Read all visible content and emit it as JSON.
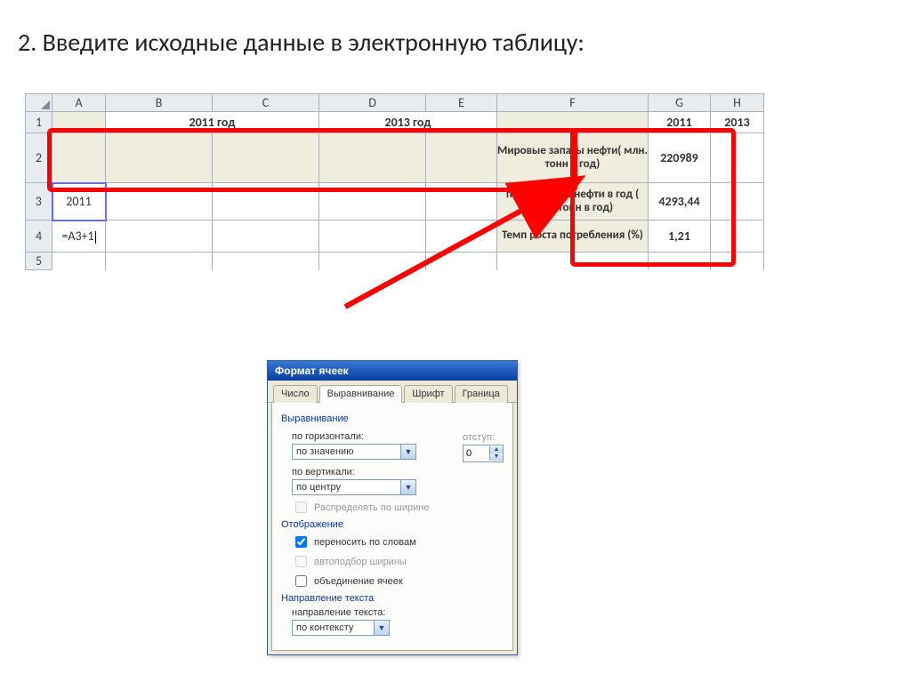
{
  "title": "2. Введите исходные данные в электронную таблицу:",
  "cols": {
    "A": "A",
    "B": "B",
    "C": "C",
    "D": "D",
    "E": "E",
    "F": "F",
    "G": "G",
    "H": "H"
  },
  "rows": {
    "r1": "1",
    "r2": "2",
    "r3": "3",
    "r4": "4",
    "r5": "5"
  },
  "cells": {
    "r1": {
      "BC": "2011 год",
      "DE": "2013 год",
      "G": "2011",
      "H": "2013"
    },
    "r2": {
      "F": "Мировые запасы нефти( млн. тонн в год)",
      "G": "220989"
    },
    "r3": {
      "A": "2011",
      "F": "потребление нефти в год ( млн. тонн в год)",
      "G": "4293,44"
    },
    "r4": {
      "A": "=A3+1",
      "F": "Темп роста потребления (%)",
      "G": "1,21"
    }
  },
  "dialog": {
    "title": "Формат ячеек",
    "tabs": {
      "num": "Число",
      "align": "Выравнивание",
      "font": "Шрифт",
      "border": "Граница"
    },
    "sec_align": "Выравнивание",
    "h_label": "по горизонтали:",
    "h_value": "по значению",
    "indent_lbl": "отступ:",
    "indent_val": "0",
    "v_label": "по вертикали:",
    "v_value": "по центру",
    "distribute": "Распределять по ширине",
    "sec_display": "Отображение",
    "wrap": "переносить по словам",
    "autofit": "автоподбор ширины",
    "merge": "объединение ячеек",
    "sec_dir": "Направление текста",
    "dir_lbl": "направление текста:",
    "dir_val": "по контексту"
  }
}
